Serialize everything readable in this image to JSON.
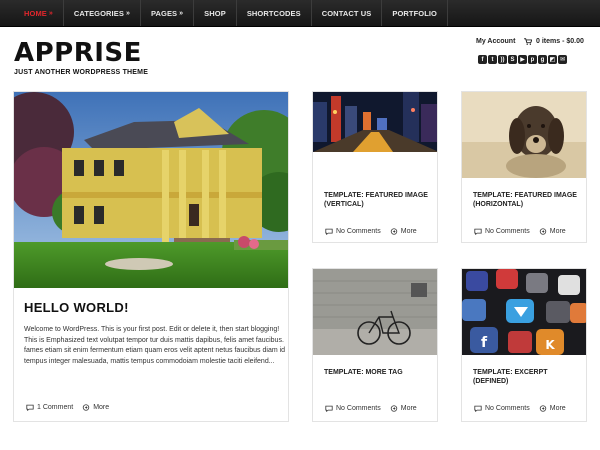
{
  "nav": {
    "items": [
      {
        "label": "HOME",
        "caret": "»",
        "active": true
      },
      {
        "label": "CATEGORIES",
        "caret": "»",
        "active": false
      },
      {
        "label": "PAGES",
        "caret": "»",
        "active": false
      },
      {
        "label": "SHOP",
        "caret": "",
        "active": false
      },
      {
        "label": "SHORTCODES",
        "caret": "",
        "active": false
      },
      {
        "label": "CONTACT US",
        "caret": "",
        "active": false
      },
      {
        "label": "PORTFOLIO",
        "caret": "",
        "active": false
      }
    ]
  },
  "header": {
    "logo": "APPRISE",
    "tagline": "JUST ANOTHER WORDPRESS THEME",
    "account_link": "My Account",
    "cart_text": "0 items - $0.00",
    "social_icons": [
      "facebook-icon",
      "twitter-icon",
      "rss-icon",
      "skype-icon",
      "youtube-icon",
      "pinterest-icon",
      "google-plus-icon",
      "delicious-icon",
      "mail-icon"
    ]
  },
  "featured_post": {
    "title": "HELLO WORLD!",
    "excerpt": "Welcome to WordPress. This is your first post. Edit or delete it, then start blogging! This is Emphasized text volutpat tempor tur duis mattis dapibus, felis amet faucibus. fames etiam sit enim fermentum etiam quam eros velit aptent netus faucibus diam id tempus integer malesuada, mattis tempus commodoiam molestie taciti eleifend...",
    "comments": "1 Comment",
    "more": "More"
  },
  "posts": [
    {
      "title": "TEMPLATE: FEATURED IMAGE (VERTICAL)",
      "comments": "No Comments",
      "more": "More"
    },
    {
      "title": "TEMPLATE: FEATURED IMAGE (HORIZONTAL)",
      "comments": "No Comments",
      "more": "More"
    },
    {
      "title": "TEMPLATE: MORE TAG",
      "comments": "No Comments",
      "more": "More"
    },
    {
      "title": "TEMPLATE: EXCERPT (DEFINED)",
      "comments": "No Comments",
      "more": "More"
    }
  ],
  "colors": {
    "accent": "#e2262c",
    "nav_bg": "#1e1e1e",
    "text": "#222222"
  }
}
